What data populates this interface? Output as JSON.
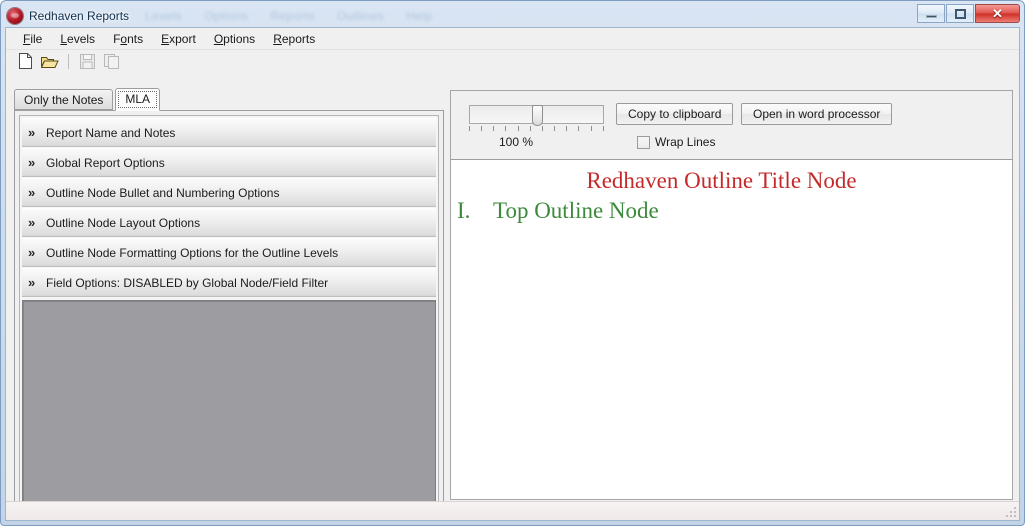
{
  "window": {
    "title": "Redhaven Reports",
    "app_icon": "redhaven-app-icon",
    "ghost_menu": [
      "Levels",
      "Options",
      "Reports",
      "Outlines",
      "Help"
    ],
    "controls": {
      "minimize": "minimize-button",
      "restore": "restore-button",
      "close_glyph": "✕"
    }
  },
  "menu": {
    "items": [
      {
        "label": "File",
        "accel": "F"
      },
      {
        "label": "Levels",
        "accel": "L"
      },
      {
        "label": "Fonts",
        "accel": "n"
      },
      {
        "label": "Export",
        "accel": "E"
      },
      {
        "label": "Options",
        "accel": "O"
      },
      {
        "label": "Reports",
        "accel": "R"
      }
    ]
  },
  "toolbar": {
    "buttons": [
      {
        "name": "new-document-icon",
        "enabled": true
      },
      {
        "name": "open-folder-icon",
        "enabled": true
      },
      {
        "name": "save-icon",
        "enabled": false
      },
      {
        "name": "copy-icon",
        "enabled": false
      }
    ]
  },
  "tabs": [
    {
      "label": "Only the Notes",
      "active": false
    },
    {
      "label": "MLA",
      "active": true
    }
  ],
  "options_pane": {
    "sections": [
      {
        "chevron": "»",
        "label": "Report Name and Notes"
      },
      {
        "chevron": "»",
        "label": "Global Report Options"
      },
      {
        "chevron": "»",
        "label": "Outline Node Bullet and Numbering Options"
      },
      {
        "chevron": "»",
        "label": "Outline Node Layout Options"
      },
      {
        "chevron": "»",
        "label": "Outline Node Formatting Options for the Outline Levels"
      },
      {
        "chevron": "»",
        "label": "Field Options:  DISABLED by Global Node/Field Filter"
      }
    ]
  },
  "preview": {
    "zoom_percent_label": "100 %",
    "zoom_value": 100,
    "copy_button_label": "Copy to clipboard",
    "open_button_label": "Open in word processor",
    "wrap_lines_label": "Wrap Lines",
    "wrap_lines_checked": false,
    "document": {
      "title": "Redhaven Outline Title Node",
      "title_color": "#c42a2a",
      "node_number": "I.",
      "node_text": "Top Outline Node",
      "node_color": "#3c8a3c"
    }
  },
  "status_bar": {
    "text": ""
  }
}
